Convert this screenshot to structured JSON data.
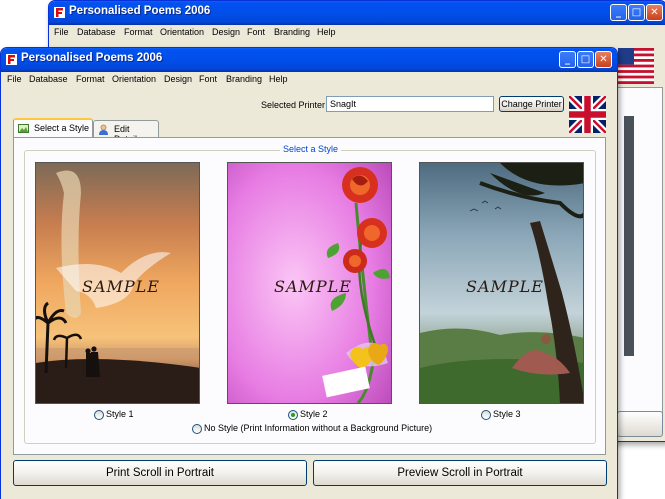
{
  "back_window": {
    "title": "Personalised Poems 2006",
    "menu": [
      "File",
      "Database",
      "Format",
      "Orientation",
      "Design",
      "Font",
      "Branding",
      "Help"
    ],
    "flag_icon": "us-flag-icon"
  },
  "front_window": {
    "title": "Personalised Poems 2006",
    "menu": [
      "File",
      "Database",
      "Format",
      "Orientation",
      "Design",
      "Font",
      "Branding",
      "Help"
    ],
    "printer_label": "Selected Printer",
    "printer_value": "SnagIt",
    "change_printer_label": "Change Printer",
    "flag_icon": "uk-flag-icon",
    "tabs": [
      {
        "label": "Select a Style",
        "active": true
      },
      {
        "label": "Edit Details",
        "active": false
      }
    ],
    "group_title": "Select a Style",
    "styles": [
      {
        "label": "Style 1",
        "watermark": "SAMPLE",
        "selected": false
      },
      {
        "label": "Style 2",
        "watermark": "SAMPLE",
        "selected": true
      },
      {
        "label": "Style 3",
        "watermark": "SAMPLE",
        "selected": false
      }
    ],
    "no_style_label": "No Style (Print Information without a Background Picture)",
    "print_button": "Print Scroll in Portrait",
    "preview_button": "Preview Scroll in Portrait"
  },
  "colors": {
    "titlebar": "#0050ee",
    "accent_tab": "#ffc83c",
    "group_title": "#0046d5",
    "radio_selected": "#21a121"
  }
}
